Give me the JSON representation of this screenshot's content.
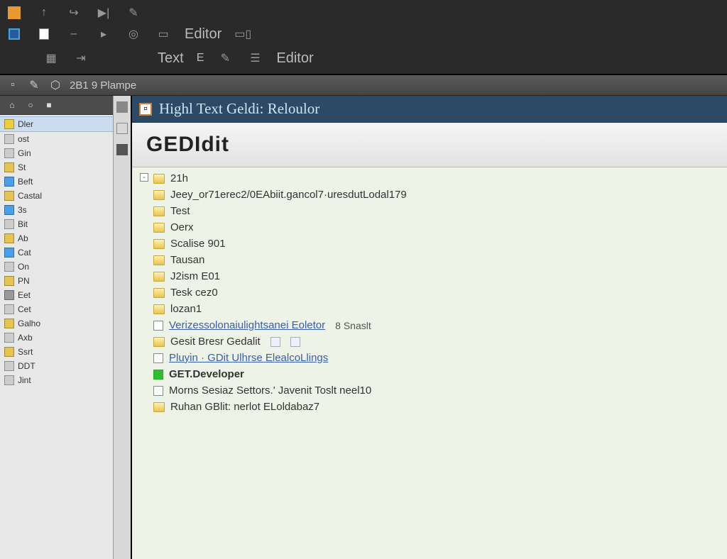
{
  "toolbar1": {
    "label1": "Editor"
  },
  "toolbar2": {
    "label1": "Text",
    "label2": "E",
    "label3": "Editor"
  },
  "tab": {
    "text": "2B1 9 Plampe"
  },
  "sidebar": {
    "items": [
      {
        "label": "Dler",
        "color": "#f0cc40"
      },
      {
        "label": "ost",
        "color": "#ccc"
      },
      {
        "label": "Gin",
        "color": "#ccc"
      },
      {
        "label": "St",
        "color": "#e6c452"
      },
      {
        "label": "Beft",
        "color": "#4aa0e8"
      },
      {
        "label": "Castal",
        "color": "#e6c452"
      },
      {
        "label": "3s",
        "color": "#4aa0e8"
      },
      {
        "label": "Bit",
        "color": "#ccc"
      },
      {
        "label": "Ab",
        "color": "#e6c452"
      },
      {
        "label": "Cat",
        "color": "#4aa0e8"
      },
      {
        "label": "On",
        "color": "#ccc"
      },
      {
        "label": "PN",
        "color": "#e6c452"
      },
      {
        "label": "Eet",
        "color": "#999"
      },
      {
        "label": "Cet",
        "color": "#ccc"
      },
      {
        "label": "Galho",
        "color": "#e6c452"
      },
      {
        "label": "Axb",
        "color": "#ccc"
      },
      {
        "label": "Ssrt",
        "color": "#e6c452"
      },
      {
        "label": "DDT",
        "color": "#ccc"
      },
      {
        "label": "Jint",
        "color": "#ccc"
      }
    ]
  },
  "doc": {
    "header_title": "Highl Text Geldi: Reloulor",
    "main_title": "GEDIdit",
    "rows": [
      {
        "type": "folder",
        "text": "21h"
      },
      {
        "type": "folder",
        "text": "Jeey_or71erec2/0EAbiit.gancol7·uresdutLodal179"
      },
      {
        "type": "folder",
        "text": "Test"
      },
      {
        "type": "folder",
        "text": "Oerx"
      },
      {
        "type": "folder",
        "text": "Scalise 901"
      },
      {
        "type": "folder",
        "text": "Tausan"
      },
      {
        "type": "folder",
        "text": "J2ism E01"
      },
      {
        "type": "folder",
        "text": "Tesk cez0"
      },
      {
        "type": "folder",
        "text": "lozan1"
      },
      {
        "type": "checklink",
        "text": "Verizessolonaiulightsanei Eoletor",
        "extra": "8 Snaslt"
      },
      {
        "type": "folder",
        "text": "Gesit Bresr Gedalit",
        "hasnum": true
      },
      {
        "type": "checklink",
        "text": "Pluyin · GDit Ulhrse ElealcoLlings"
      },
      {
        "type": "greencheck",
        "text": "GET.Developer"
      },
      {
        "type": "check",
        "text": "Morns  Sesiaz Settors.' Javenit Toslt neel10"
      },
      {
        "type": "folder",
        "text": "Ruhan  GBlit: nerlot ELoldabaz7"
      }
    ]
  }
}
